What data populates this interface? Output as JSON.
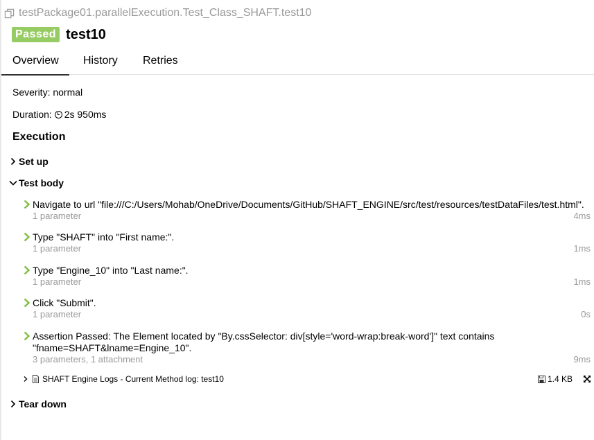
{
  "breadcrumb": {
    "text": "testPackage01.parallelExecution.Test_Class_SHAFT.test10"
  },
  "header": {
    "status": "Passed",
    "name": "test10"
  },
  "tabs": [
    {
      "label": "Overview",
      "active": true
    },
    {
      "label": "History",
      "active": false
    },
    {
      "label": "Retries",
      "active": false
    }
  ],
  "overview": {
    "severity_label": "Severity:",
    "severity_value": "normal",
    "duration_label": "Duration:",
    "duration_value": "2s 950ms"
  },
  "execution": {
    "title": "Execution",
    "setup_label": "Set up",
    "body_label": "Test body",
    "teardown_label": "Tear down",
    "steps": [
      {
        "text": "Navigate to url \"file:///C:/Users/Mohab/OneDrive/Documents/GitHub/SHAFT_ENGINE/src/test/resources/testDataFiles/test.html\".",
        "sub": "1 parameter",
        "time": "4ms"
      },
      {
        "text": "Type \"SHAFT\" into \"First name:\".",
        "sub": "1 parameter",
        "time": "1ms"
      },
      {
        "text": "Type \"Engine_10\" into \"Last name:\".",
        "sub": "1 parameter",
        "time": "1ms"
      },
      {
        "text": "Click \"Submit\".",
        "sub": "1 parameter",
        "time": "0s"
      },
      {
        "text_line1": "Assertion Passed: The Element located by \"By.cssSelector: div[style='word-wrap:break-word']\" text contains",
        "text_line2": "\"fname=SHAFT&lname=Engine_10\".",
        "sub": "3 parameters, 1 attachment",
        "time": "9ms"
      }
    ],
    "attachment": {
      "name": "SHAFT Engine Logs - Current Method log: test10",
      "size": "1.4 KB"
    }
  },
  "colors": {
    "passed": "#97cc64",
    "muted": "#999999",
    "step_arrow": "#7fbf3f"
  }
}
